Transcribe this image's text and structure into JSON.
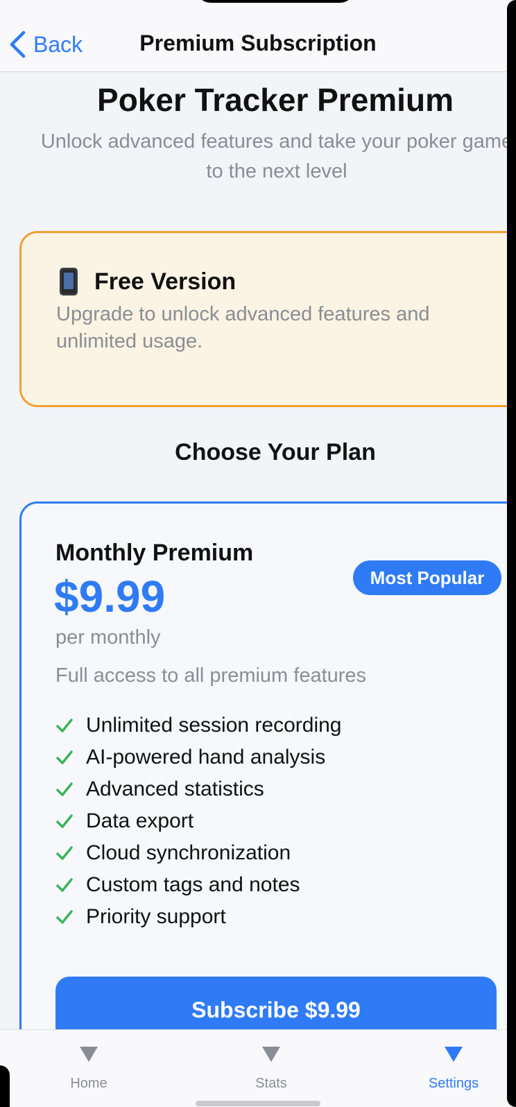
{
  "nav": {
    "back_label": "Back",
    "title": "Premium Subscription"
  },
  "header": {
    "title": "Poker Tracker Premium",
    "subtitle": "Unlock advanced features and take your poker game to the next level"
  },
  "status_card": {
    "icon": "mobile-phone-icon",
    "title": "Free Version",
    "description": "Upgrade to unlock advanced features and unlimited usage."
  },
  "plans_section": {
    "title": "Choose Your Plan"
  },
  "plan": {
    "badge": "Most Popular",
    "name": "Monthly Premium",
    "price": "$9.99",
    "period": "per monthly",
    "description": "Full access to all premium features",
    "features": [
      "Unlimited session recording",
      "AI-powered hand analysis",
      "Advanced statistics",
      "Data export",
      "Cloud synchronization",
      "Custom tags and notes",
      "Priority support"
    ],
    "subscribe_label": "Subscribe $9.99"
  },
  "tabbar": {
    "tabs": [
      {
        "label": "Home",
        "icon": "triangle-down-icon",
        "active": false
      },
      {
        "label": "Stats",
        "icon": "triangle-down-icon",
        "active": false
      },
      {
        "label": "Settings",
        "icon": "triangle-down-icon",
        "active": true
      }
    ]
  },
  "colors": {
    "accent": "#2f7bf6",
    "warning_border": "#f0a030",
    "warning_bg": "#fbf3e3",
    "check": "#3bb45a"
  }
}
